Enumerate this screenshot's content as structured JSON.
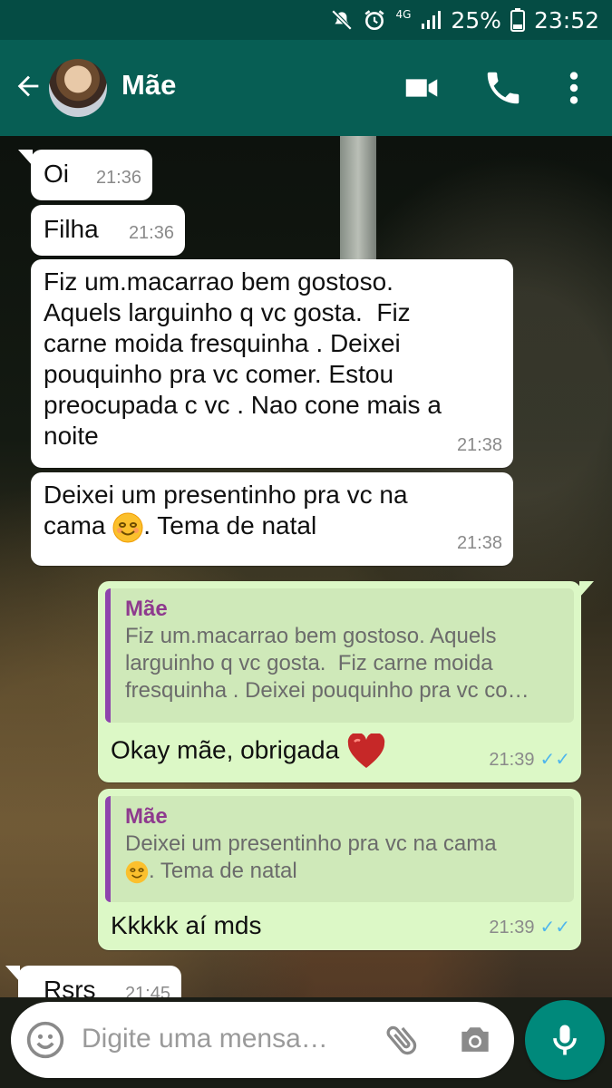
{
  "status_bar": {
    "network": "4G",
    "battery": "25%",
    "time": "23:52"
  },
  "header": {
    "contact_name": "Mãe"
  },
  "messages": [
    {
      "text": "Oi",
      "time": "21:36"
    },
    {
      "text": "Filha",
      "time": "21:36"
    },
    {
      "text": "Fiz um.macarrao bem gostoso.\nAquels larguinho q vc gosta.  Fiz\ncarne moida fresquinha . Deixei\npouquinho pra vc comer. Estou\npreocupada c vc . Nao cone mais a\nnoite",
      "time": "21:38"
    },
    {
      "text_a": "Deixei um presentinho pra vc na",
      "text_b": "cama",
      "text_c": ". Tema de natal",
      "time": "21:38"
    },
    {
      "quote_name": "Mãe",
      "quote_text": "Fiz um.macarrao bem gostoso. Aquels\nlarguinho q vc gosta.  Fiz carne moida\nfresquinha . Deixei pouquinho pra vc co…",
      "text": "Okay mãe, obrigada",
      "time": "21:39"
    },
    {
      "quote_name": "Mãe",
      "quote_text_a": "Deixei um presentinho pra vc na cama",
      "quote_text_b": ". Tema de natal",
      "text": "Kkkkk aí mds",
      "time": "21:39"
    },
    {
      "text": "Rsrs",
      "time": "21:45"
    }
  ],
  "composer": {
    "placeholder": "Digite uma mensa…"
  },
  "colors": {
    "header": "#075e54",
    "status_bar": "#054c44",
    "outgoing": "#dcf8c6",
    "incoming": "#ffffff",
    "mic": "#00897b",
    "ticks": "#4fb6ec",
    "quote_bar": "#8e44ad"
  }
}
